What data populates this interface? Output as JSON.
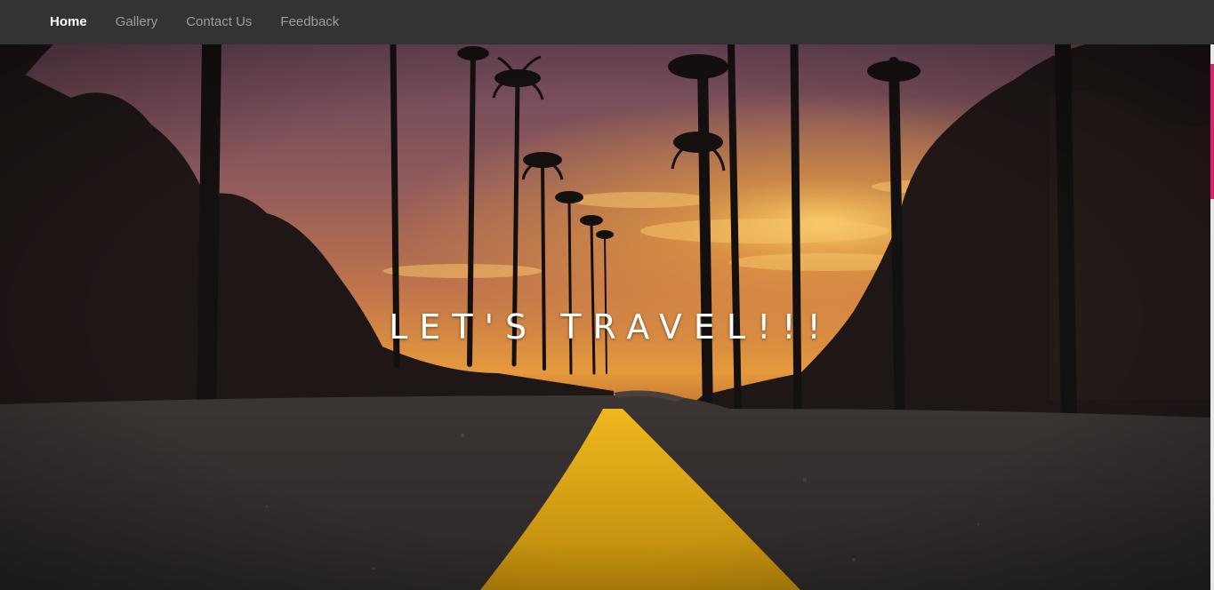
{
  "nav": {
    "items": [
      {
        "label": "Home",
        "active": true
      },
      {
        "label": "Gallery",
        "active": false
      },
      {
        "label": "Contact Us",
        "active": false
      },
      {
        "label": "Feedback",
        "active": false
      }
    ]
  },
  "hero": {
    "title": "LET'S TRAVEL!!!",
    "image": "sunset-road-with-palm-trees"
  },
  "colors": {
    "navbar_bg": "#333333",
    "nav_text": "#9d9d9d",
    "nav_active_text": "#ffffff",
    "scrollbar_thumb": "#e0206e",
    "road_line": "#e0a615"
  }
}
